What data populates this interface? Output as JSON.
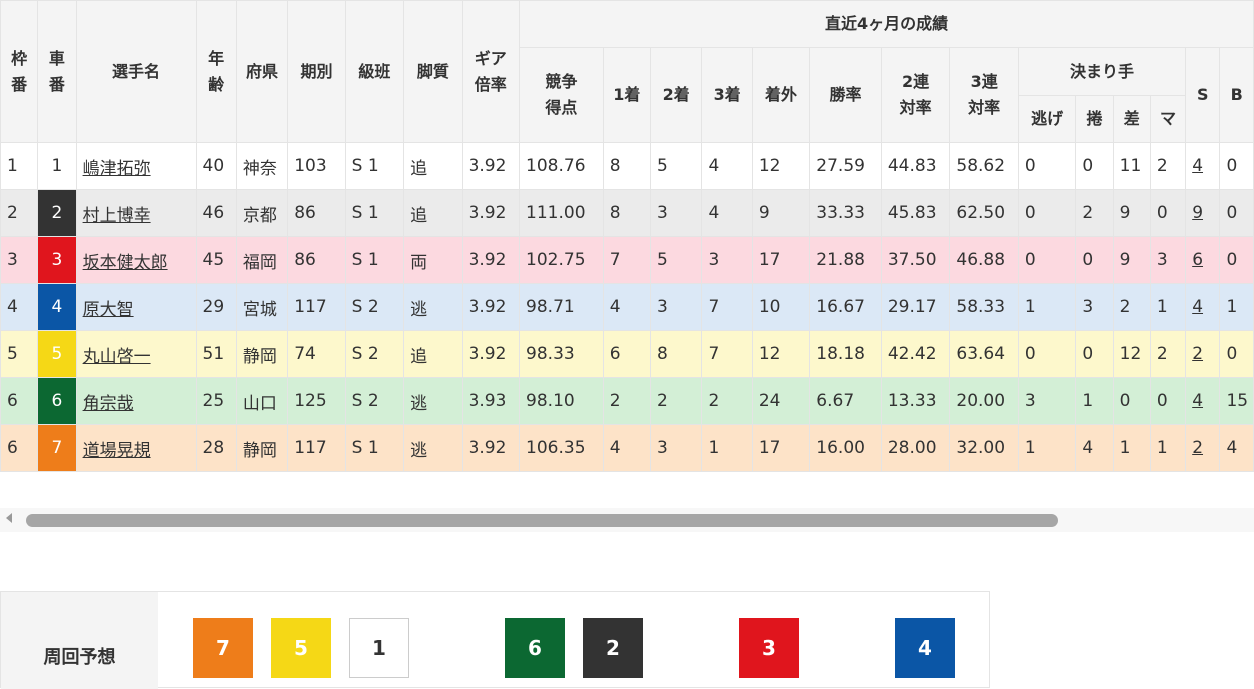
{
  "table": {
    "headers": {
      "waku": "枠番",
      "car": "車番",
      "name": "選手名",
      "age": "年齢",
      "pref": "府県",
      "term": "期別",
      "class": "級班",
      "style": "脚質",
      "gear": "ギア倍率",
      "recent": "直近4ヶ月の成績",
      "score": "競争得点",
      "first": "1着",
      "second": "2着",
      "third": "3着",
      "out": "着外",
      "win_rate": "勝率",
      "quinella_rate": "2連対率",
      "trifecta_rate": "3連対率",
      "kimarite": "決まり手",
      "nige": "逃げ",
      "makuri": "捲",
      "sashi": "差",
      "mark": "マ",
      "s": "S",
      "b": "B"
    },
    "rows": [
      {
        "waku": "1",
        "car": "1",
        "name": "嶋津拓弥",
        "age": "40",
        "pref": "神奈",
        "term": "103",
        "class": "S 1",
        "style": "追",
        "gear": "3.92",
        "score": "108.76",
        "first": "8",
        "second": "5",
        "third": "4",
        "out": "12",
        "win_rate": "27.59",
        "quinella_rate": "44.83",
        "trifecta_rate": "58.62",
        "nige": "0",
        "makuri": "0",
        "sashi": "11",
        "mark": "2",
        "s": "4",
        "b": "0",
        "row_bg": "#ffffff",
        "car_bg": "#ffffff",
        "car_fg": "#333333"
      },
      {
        "waku": "2",
        "car": "2",
        "name": "村上博幸",
        "age": "46",
        "pref": "京都",
        "term": "86",
        "class": "S 1",
        "style": "追",
        "gear": "3.92",
        "score": "111.00",
        "first": "8",
        "second": "3",
        "third": "4",
        "out": "9",
        "win_rate": "33.33",
        "quinella_rate": "45.83",
        "trifecta_rate": "62.50",
        "nige": "0",
        "makuri": "2",
        "sashi": "9",
        "mark": "0",
        "s": "9",
        "b": "0",
        "row_bg": "#ebebeb",
        "car_bg": "#333333",
        "car_fg": "#ffffff"
      },
      {
        "waku": "3",
        "car": "3",
        "name": "坂本健太郎",
        "age": "45",
        "pref": "福岡",
        "term": "86",
        "class": "S 1",
        "style": "両",
        "gear": "3.92",
        "score": "102.75",
        "first": "7",
        "second": "5",
        "third": "3",
        "out": "17",
        "win_rate": "21.88",
        "quinella_rate": "37.50",
        "trifecta_rate": "46.88",
        "nige": "0",
        "makuri": "0",
        "sashi": "9",
        "mark": "3",
        "s": "6",
        "b": "0",
        "row_bg": "#fcd9e0",
        "car_bg": "#e0151d",
        "car_fg": "#ffffff"
      },
      {
        "waku": "4",
        "car": "4",
        "name": "原大智",
        "age": "29",
        "pref": "宮城",
        "term": "117",
        "class": "S 2",
        "style": "逃",
        "gear": "3.92",
        "score": "98.71",
        "first": "4",
        "second": "3",
        "third": "7",
        "out": "10",
        "win_rate": "16.67",
        "quinella_rate": "29.17",
        "trifecta_rate": "58.33",
        "nige": "1",
        "makuri": "3",
        "sashi": "2",
        "mark": "1",
        "s": "4",
        "b": "1",
        "row_bg": "#dbe8f6",
        "car_bg": "#0b56a6",
        "car_fg": "#ffffff"
      },
      {
        "waku": "5",
        "car": "5",
        "name": "丸山啓一",
        "age": "51",
        "pref": "静岡",
        "term": "74",
        "class": "S 2",
        "style": "追",
        "gear": "3.92",
        "score": "98.33",
        "first": "6",
        "second": "8",
        "third": "7",
        "out": "12",
        "win_rate": "18.18",
        "quinella_rate": "42.42",
        "trifecta_rate": "63.64",
        "nige": "0",
        "makuri": "0",
        "sashi": "12",
        "mark": "2",
        "s": "2",
        "b": "0",
        "row_bg": "#fdf8cc",
        "car_bg": "#f5d816",
        "car_fg": "#ffffff"
      },
      {
        "waku": "6",
        "car": "6",
        "name": "角宗哉",
        "age": "25",
        "pref": "山口",
        "term": "125",
        "class": "S 2",
        "style": "逃",
        "gear": "3.93",
        "score": "98.10",
        "first": "2",
        "second": "2",
        "third": "2",
        "out": "24",
        "win_rate": "6.67",
        "quinella_rate": "13.33",
        "trifecta_rate": "20.00",
        "nige": "3",
        "makuri": "1",
        "sashi": "0",
        "mark": "0",
        "s": "4",
        "b": "15",
        "row_bg": "#d3efd6",
        "car_bg": "#0c6832",
        "car_fg": "#ffffff"
      },
      {
        "waku": "6",
        "car": "7",
        "name": "道場晃規",
        "age": "28",
        "pref": "静岡",
        "term": "117",
        "class": "S 1",
        "style": "逃",
        "gear": "3.92",
        "score": "106.35",
        "first": "4",
        "second": "3",
        "third": "1",
        "out": "17",
        "win_rate": "16.00",
        "quinella_rate": "28.00",
        "trifecta_rate": "32.00",
        "nige": "1",
        "makuri": "4",
        "sashi": "1",
        "mark": "1",
        "s": "2",
        "b": "4",
        "row_bg": "#fde3c8",
        "car_bg": "#ee7d1a",
        "car_fg": "#ffffff"
      }
    ]
  },
  "prediction": {
    "label": "周回予想",
    "boxes": [
      {
        "num": "7",
        "bg": "#ee7d1a",
        "fg": "#ffffff"
      },
      {
        "num": "5",
        "bg": "#f5d816",
        "fg": "#ffffff"
      },
      {
        "num": "1",
        "bg": "#ffffff",
        "fg": "#333333"
      },
      {
        "num": "6",
        "bg": "#0c6832",
        "fg": "#ffffff"
      },
      {
        "num": "2",
        "bg": "#333333",
        "fg": "#ffffff"
      },
      {
        "num": "3",
        "bg": "#e0151d",
        "fg": "#ffffff"
      },
      {
        "num": "4",
        "bg": "#0b56a6",
        "fg": "#ffffff"
      }
    ]
  }
}
